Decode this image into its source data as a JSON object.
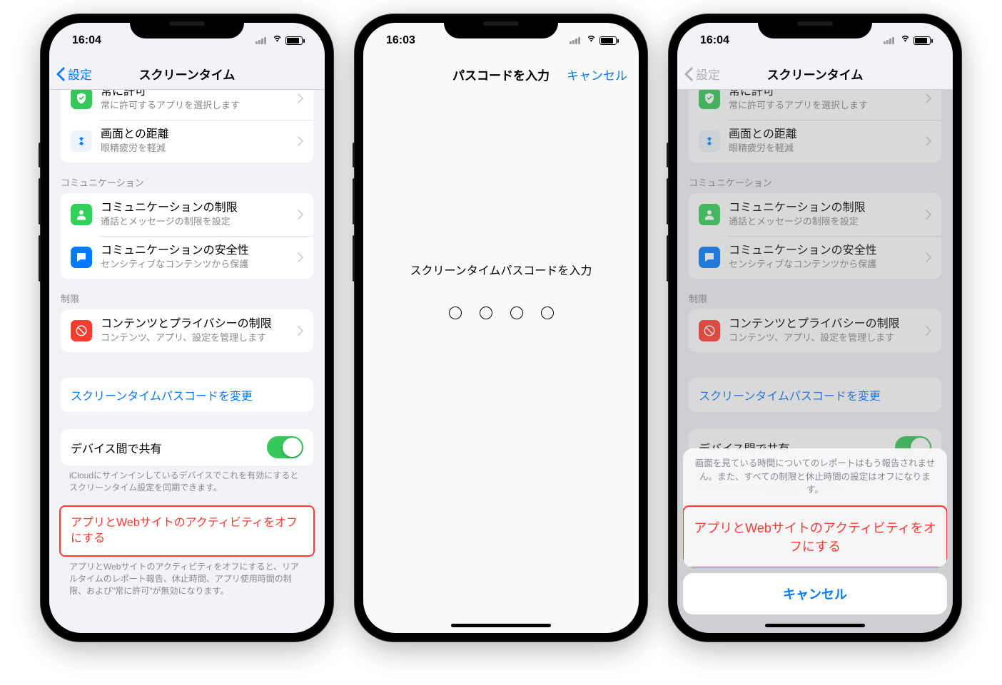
{
  "screens": {
    "left": {
      "time": "16:04",
      "nav_back": "設定",
      "nav_title": "スクリーンタイム",
      "row_always": {
        "title": "常に許可",
        "subtitle": "常に許可するアプリを選択します"
      },
      "row_distance": {
        "title": "画面との距離",
        "subtitle": "眼精疲労を軽減"
      },
      "section_comm": "コミュニケーション",
      "row_comm_limit": {
        "title": "コミュニケーションの制限",
        "subtitle": "通話とメッセージの制限を設定"
      },
      "row_comm_safety": {
        "title": "コミュニケーションの安全性",
        "subtitle": "センシティブなコンテンツから保護"
      },
      "section_restrict": "制限",
      "row_content": {
        "title": "コンテンツとプライバシーの制限",
        "subtitle": "コンテンツ、アプリ、設定を管理します"
      },
      "link_passcode": "スクリーンタイムパスコードを変更",
      "toggle_label": "デバイス間で共有",
      "toggle_footer": "iCloudにサインインしているデバイスでこれを有効にするとスクリーンタイム設定を同期できます。",
      "turn_off": "アプリとWebサイトのアクティビティをオフにする",
      "turn_off_footer": "アプリとWebサイトのアクティビティをオフにすると、リアルタイムのレポート報告、休止時間、アプリ使用時間の制限、および\"常に許可\"が無効になります。"
    },
    "middle": {
      "time": "16:03",
      "nav_title": "パスコードを入力",
      "nav_cancel": "キャンセル",
      "passcode_label": "スクリーンタイムパスコードを入力"
    },
    "right": {
      "time": "16:04",
      "nav_back": "設定",
      "nav_title": "スクリーンタイム",
      "sheet_header": "画面を見ている時間についてのレポートはもう報告されません。また、すべての制限と休止時間の設定はオフになります。",
      "sheet_action": "アプリとWebサイトのアクティビティをオフにする",
      "sheet_cancel": "キャンセル"
    }
  }
}
